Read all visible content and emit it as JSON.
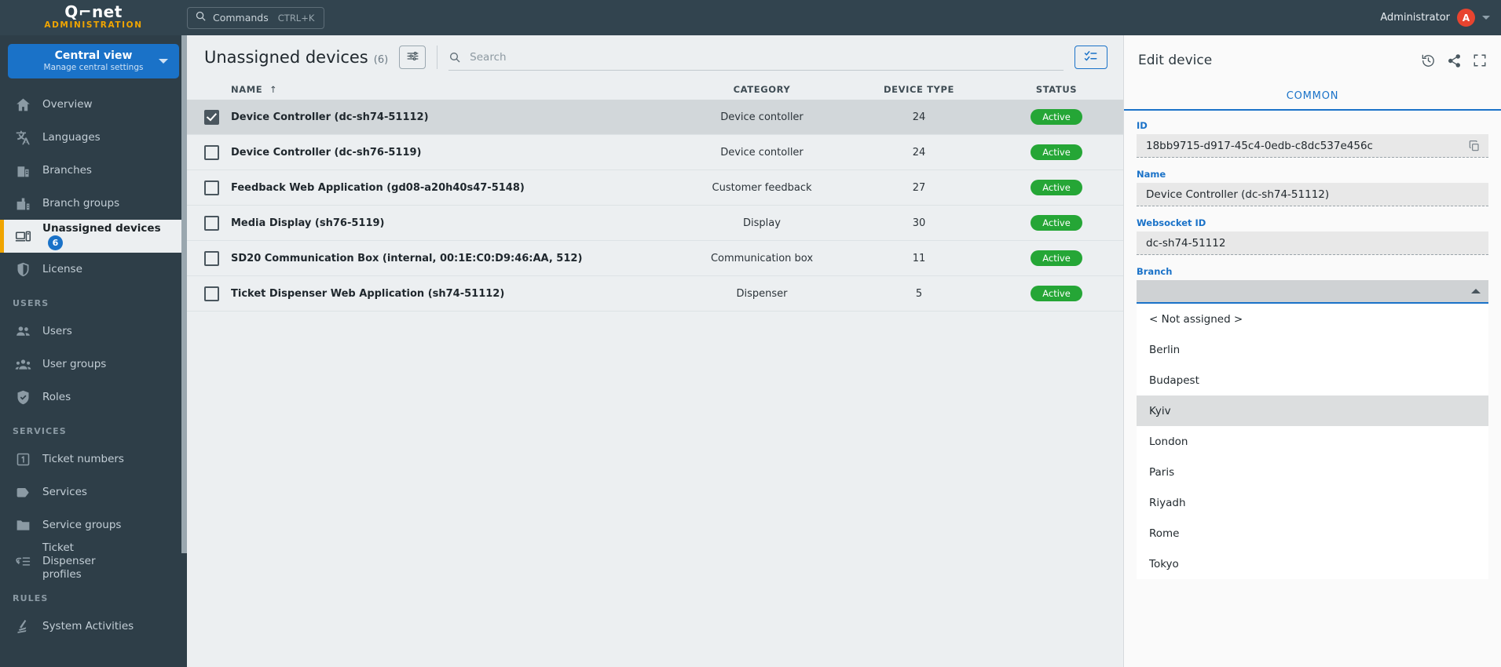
{
  "topbar": {
    "brand_logo": "Q⌐net",
    "brand_sub": "ADMINISTRATION",
    "commands_label": "Commands",
    "commands_shortcut": "CTRL+K",
    "admin_name": "Administrator",
    "avatar_initial": "A"
  },
  "sidebar": {
    "view_title": "Central view",
    "view_subtitle": "Manage central settings",
    "groups": [
      {
        "title": "",
        "items": [
          {
            "label": "Overview",
            "icon": "home-icon",
            "active": false,
            "badge": ""
          },
          {
            "label": "Languages",
            "icon": "language-icon",
            "active": false,
            "badge": ""
          },
          {
            "label": "Branches",
            "icon": "building-icon",
            "active": false,
            "badge": ""
          },
          {
            "label": "Branch groups",
            "icon": "buildings-icon",
            "active": false,
            "badge": ""
          },
          {
            "label": "Unassigned devices",
            "icon": "devices-icon",
            "active": true,
            "badge": "6"
          },
          {
            "label": "License",
            "icon": "shield-icon",
            "active": false,
            "badge": ""
          }
        ]
      },
      {
        "title": "USERS",
        "items": [
          {
            "label": "Users",
            "icon": "users-icon",
            "active": false,
            "badge": ""
          },
          {
            "label": "User groups",
            "icon": "user-groups-icon",
            "active": false,
            "badge": ""
          },
          {
            "label": "Roles",
            "icon": "shield-check-icon",
            "active": false,
            "badge": ""
          }
        ]
      },
      {
        "title": "SERVICES",
        "items": [
          {
            "label": "Ticket numbers",
            "icon": "number-box-icon",
            "active": false,
            "badge": ""
          },
          {
            "label": "Services",
            "icon": "tag-icon",
            "active": false,
            "badge": ""
          },
          {
            "label": "Service groups",
            "icon": "folder-icon",
            "active": false,
            "badge": ""
          },
          {
            "label": "Ticket Dispenser profiles",
            "icon": "dispenser-profile-icon",
            "active": false,
            "badge": ""
          }
        ]
      },
      {
        "title": "RULES",
        "items": [
          {
            "label": "System Activities",
            "icon": "activities-icon",
            "active": false,
            "badge": ""
          }
        ]
      }
    ]
  },
  "main": {
    "title": "Unassigned devices",
    "count": "(6)",
    "filter_icon": "sliders-icon",
    "search_placeholder": "Search",
    "search_value": "",
    "select_mode_icon": "checklist-icon",
    "columns": [
      "NAME",
      "CATEGORY",
      "DEVICE TYPE",
      "STATUS"
    ],
    "sort_indicator": "↑",
    "rows": [
      {
        "checked": true,
        "name": "Device Controller (dc-sh74-51112)",
        "category": "Device contoller",
        "device_type": "24",
        "status": "Active"
      },
      {
        "checked": false,
        "name": "Device Controller (dc-sh76-5119)",
        "category": "Device contoller",
        "device_type": "24",
        "status": "Active"
      },
      {
        "checked": false,
        "name": "Feedback Web Application (gd08-a20h40s47-5148)",
        "category": "Customer feedback",
        "device_type": "27",
        "status": "Active"
      },
      {
        "checked": false,
        "name": "Media Display (sh76-5119)",
        "category": "Display",
        "device_type": "30",
        "status": "Active"
      },
      {
        "checked": false,
        "name": "SD20 Communication Box (internal, 00:1E:C0:D9:46:AA, 512)",
        "category": "Communication box",
        "device_type": "11",
        "status": "Active"
      },
      {
        "checked": false,
        "name": "Ticket Dispenser Web Application (sh74-51112)",
        "category": "Dispenser",
        "device_type": "5",
        "status": "Active"
      }
    ]
  },
  "panel": {
    "title": "Edit device",
    "header_icons": [
      "history-icon",
      "share-icon",
      "fullscreen-icon"
    ],
    "tab_label": "COMMON",
    "fields": [
      {
        "label": "ID",
        "value": "18bb9715-d917-45c4-0edb-c8dc537e456c",
        "copy": true
      },
      {
        "label": "Name",
        "value": "Device Controller (dc-sh74-51112)",
        "copy": false
      },
      {
        "label": "Websocket ID",
        "value": "dc-sh74-51112",
        "copy": false
      }
    ],
    "branch": {
      "label": "Branch",
      "selected": "",
      "options": [
        {
          "label": "< Not assigned >",
          "highlighted": false
        },
        {
          "label": "Berlin",
          "highlighted": false
        },
        {
          "label": "Budapest",
          "highlighted": false
        },
        {
          "label": "Kyiv",
          "highlighted": true
        },
        {
          "label": "London",
          "highlighted": false
        },
        {
          "label": "Paris",
          "highlighted": false
        },
        {
          "label": "Riyadh",
          "highlighted": false
        },
        {
          "label": "Rome",
          "highlighted": false
        },
        {
          "label": "Tokyo",
          "highlighted": false
        }
      ]
    }
  },
  "colors": {
    "topbar_bg": "#32444f",
    "sidebar_bg": "#2e3e48",
    "accent_blue": "#1a72c8",
    "accent_orange": "#f0a500",
    "status_green": "#25a636",
    "avatar_red": "#e8442f"
  }
}
